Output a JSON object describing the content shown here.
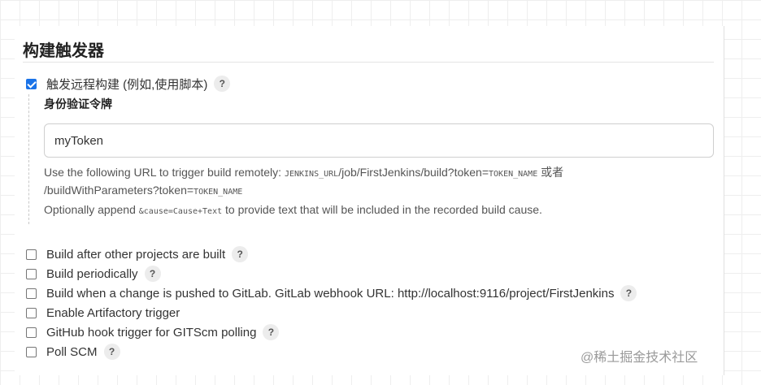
{
  "section": {
    "title": "构建触发器"
  },
  "remote_trigger": {
    "checked": true,
    "label": "触发远程构建 (例如,使用脚本)",
    "help_icon": "?",
    "token_label": "身份验证令牌",
    "token_value": "myToken",
    "desc_line1_prefix": "Use the following URL to trigger build remotely: ",
    "desc_line1_code1": "JENKINS_URL",
    "desc_line1_middle": "/job/FirstJenkins/build?token=",
    "desc_line1_code2": "TOKEN_NAME",
    "desc_line1_suffix": " 或者",
    "desc_line2_prefix": "/buildWithParameters?token=",
    "desc_line2_code": "TOKEN_NAME",
    "desc_line3_prefix": "Optionally append ",
    "desc_line3_code": "&cause=Cause+Text",
    "desc_line3_suffix": " to provide text that will be included in the recorded build cause."
  },
  "triggers": [
    {
      "label": "Build after other projects are built",
      "checked": false,
      "help_icon": "?"
    },
    {
      "label": "Build periodically",
      "checked": false,
      "help_icon": "?"
    },
    {
      "label": "Build when a change is pushed to GitLab. GitLab webhook URL: http://localhost:9116/project/FirstJenkins",
      "checked": false,
      "help_icon": "?"
    },
    {
      "label": "Enable Artifactory trigger",
      "checked": false
    },
    {
      "label": "GitHub hook trigger for GITScm polling",
      "checked": false,
      "help_icon": "?"
    },
    {
      "label": "Poll SCM",
      "checked": false,
      "help_icon": "?"
    }
  ],
  "watermark": "@稀土掘金技术社区"
}
